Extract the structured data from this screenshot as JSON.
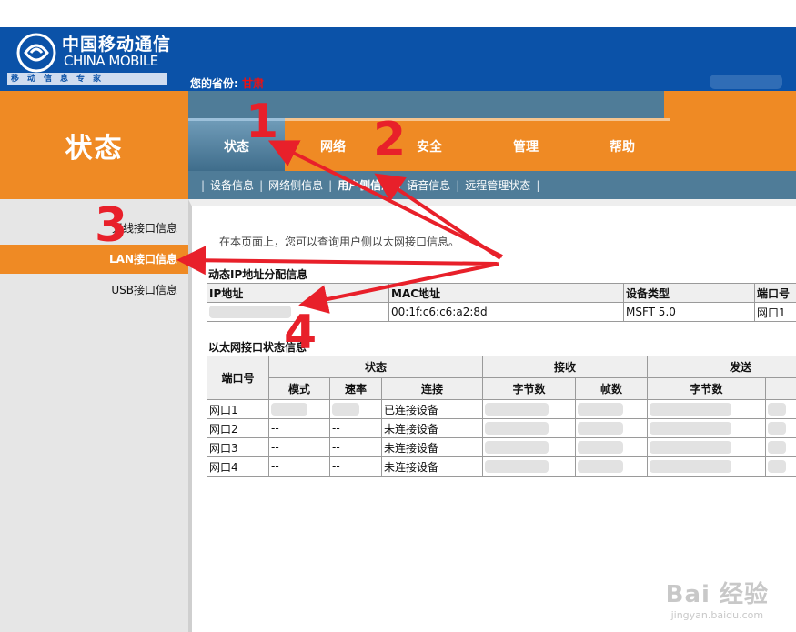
{
  "header": {
    "logo_cn": "中国移动通信",
    "logo_en": "CHINA MOBILE",
    "logo_tagline": "移动信息专家",
    "province_label": "您的省份:",
    "province_value": "甘肃",
    "brand_color": "#0b52a8",
    "accent_color": "#ef8a24"
  },
  "section_title": "状态",
  "tabs": [
    {
      "label": "状态",
      "active": true
    },
    {
      "label": "网络",
      "active": false
    },
    {
      "label": "安全",
      "active": false
    },
    {
      "label": "管理",
      "active": false
    },
    {
      "label": "帮助",
      "active": false
    }
  ],
  "subnav": [
    {
      "label": "设备信息",
      "active": false
    },
    {
      "label": "网络侧信息",
      "active": false
    },
    {
      "label": "用户侧信息",
      "active": true
    },
    {
      "label": "语音信息",
      "active": false
    },
    {
      "label": "远程管理状态",
      "active": false
    }
  ],
  "left_nav": [
    {
      "label": "无线接口信息",
      "active": false
    },
    {
      "label": "LAN接口信息",
      "active": true
    },
    {
      "label": "USB接口信息",
      "active": false
    }
  ],
  "page_desc": "在本页面上，您可以查询用户侧以太网接口信息。",
  "dhcp": {
    "title": "动态IP地址分配信息",
    "headers": [
      "IP地址",
      "MAC地址",
      "设备类型",
      "端口号"
    ],
    "rows": [
      [
        "",
        "00:1f:c6:c6:a2:8d",
        "MSFT 5.0",
        "网口1"
      ]
    ]
  },
  "eth": {
    "title": "以太网接口状态信息",
    "h_port": "端口号",
    "h_status": "状态",
    "h_recv": "接收",
    "h_send": "发送",
    "h_mode": "模式",
    "h_rate": "速率",
    "h_conn": "连接",
    "h_bytes_recv": "字节数",
    "h_frames_recv": "帧数",
    "h_bytes_send": "字节数",
    "rows": [
      {
        "port": "网口1",
        "mode": "",
        "rate": "",
        "conn": "已连接设备"
      },
      {
        "port": "网口2",
        "mode": "--",
        "rate": "--",
        "conn": "未连接设备"
      },
      {
        "port": "网口3",
        "mode": "--",
        "rate": "--",
        "conn": "未连接设备"
      },
      {
        "port": "网口4",
        "mode": "--",
        "rate": "--",
        "conn": "未连接设备"
      }
    ]
  },
  "annotations": {
    "n1": "1",
    "n2": "2",
    "n3": "3",
    "n4": "4",
    "arrow_color": "#e8202a"
  },
  "watermark": {
    "logo": "Bai 经验",
    "url": "jingyan.baidu.com"
  }
}
